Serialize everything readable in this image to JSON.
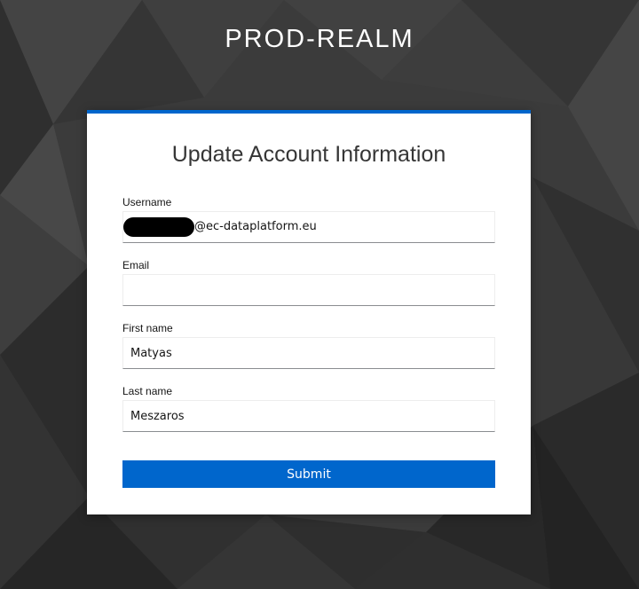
{
  "realm": {
    "title": "PROD-REALM"
  },
  "form": {
    "title": "Update Account Information",
    "fields": [
      {
        "label": "Username",
        "value": "@ec-dataplatform.eu",
        "redacted_prefix": true
      },
      {
        "label": "Email",
        "value": ""
      },
      {
        "label": "First name",
        "value": "Matyas"
      },
      {
        "label": "Last name",
        "value": "Meszaros"
      }
    ],
    "submit_label": "Submit"
  },
  "colors": {
    "accent": "#0066cc",
    "background": "#3a3a3a",
    "card": "#ffffff"
  }
}
